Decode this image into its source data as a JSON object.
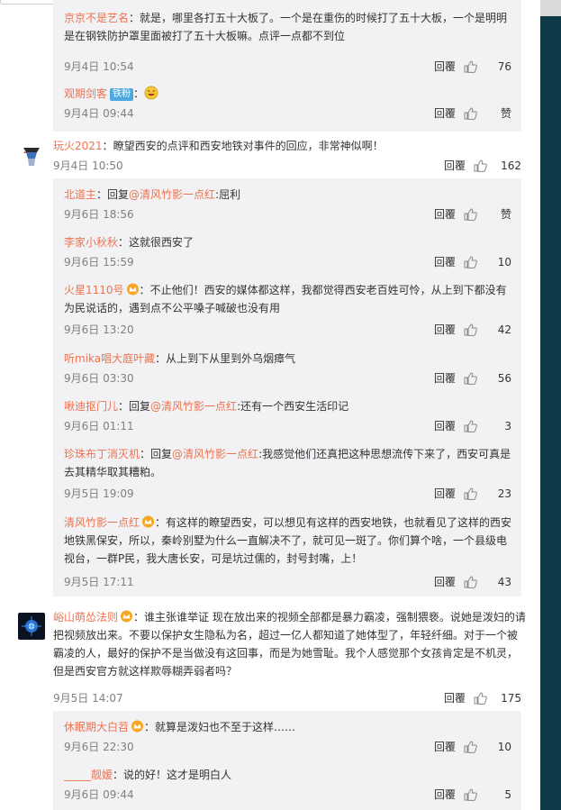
{
  "colors": {
    "name": "#eb7350",
    "text": "#333333",
    "meta": "#808080",
    "subbg": "#f2f2f5",
    "rightbar": "#0e3a47"
  },
  "labels": {
    "reply": "回覆"
  },
  "icons": {
    "like": "thumbs-up-icon",
    "vip": "crown-badge-icon",
    "laugh": "laughing-emoji-icon"
  },
  "sub0": [
    {
      "name": "京京不是艺名",
      "sep": "：",
      "text": "就是，哪里各打五十大板了。一个是在重伤的时候打了五十大板，一个是明明是在钢铁防护罩里面被打了五十大板嘛。点评一点都不到位",
      "time": "9月4日 10:54",
      "likes": "76"
    },
    {
      "name": "观期剑客",
      "badge": "铁粉",
      "sep": "：",
      "time": "9月4日 09:44",
      "likes": "赞"
    }
  ],
  "c1": {
    "name": "玩火2021",
    "sep": "：",
    "text": "瞭望西安的点评和西安地铁对事件的回应，非常神似啊！",
    "time": "9月4日 10:50",
    "likes": "162"
  },
  "sub1": [
    {
      "name": "北道主",
      "sep": "：",
      "pre": "回复",
      "at": "@清风竹影一点红",
      "text": ":屈利",
      "time": "9月6日 18:56",
      "likes": "赞"
    },
    {
      "name": "李家小秋秋",
      "sep": "：",
      "text": "这就很西安了",
      "time": "9月6日 15:59",
      "likes": "10"
    },
    {
      "name": "火星1110号",
      "sep": "：",
      "text": "不止他们！西安的媒体都这样，我都觉得西安老百姓可怜，从上到下都没有为民说话的，遇到点不公平嗓子喊破也没有用",
      "time": "9月6日 13:20",
      "likes": "42"
    },
    {
      "name": "听mika唱大庭叶藏",
      "sep": "：",
      "text": "从上到下从里到外乌烟瘴气",
      "time": "9月6日 03:30",
      "likes": "56"
    },
    {
      "name": "啾迪抠门儿",
      "sep": "：",
      "pre": "回复",
      "at": "@清风竹影一点红",
      "text": ":还有一个西安生活印记",
      "time": "9月6日 01:11",
      "likes": "3"
    },
    {
      "name": "珍珠布丁消灭机",
      "sep": "：",
      "pre": "回复",
      "at": "@清风竹影一点红",
      "text": ":我感觉他们还真把这种思想流传下来了，西安可真是去其精华取其糟粕。",
      "time": "9月5日 19:09",
      "likes": "23"
    },
    {
      "name": "清风竹影一点红",
      "sep": "：",
      "text": "有这样的瞭望西安，可以想见有这样的西安地铁，也就看见了这样的西安地铁黑保安，所以，秦岭别墅为什么一直解决不了，就可见一斑了。你们算个啥，一个县级电视台，一群P民，我大唐长安，可是坑过儒的，封号封嘴，上！",
      "time": "9月5日 17:11",
      "likes": "43"
    }
  ],
  "c2": {
    "name": "峪山萌怂法则",
    "sep": "：",
    "text": "谁主张谁举证 现在放出来的视频全部都是暴力霸凌，强制猥亵。说她是泼妇的请把视频放出来。不要以保护女生隐私为名，超过一亿人都知道了她体型了，年轻纤细。对于一个被霸凌的人，最好的保护不是当做没有这回事，而是为她雪耻。我个人感觉那个女孩肯定是不机灵，但是西安官方就这样欺辱糊弄弱者吗？",
    "time": "9月5日 14:07",
    "likes": "175"
  },
  "sub2": [
    {
      "name": "休眠期大白苕",
      "sep": "：",
      "text": "就算是泼妇也不至于这样……",
      "time": "9月6日 22:30",
      "likes": "10"
    },
    {
      "name": "_____靓嫒",
      "sep": "：",
      "text": "说的好！这才是明白人",
      "time": "9月6日 09:44",
      "likes": "5"
    }
  ]
}
